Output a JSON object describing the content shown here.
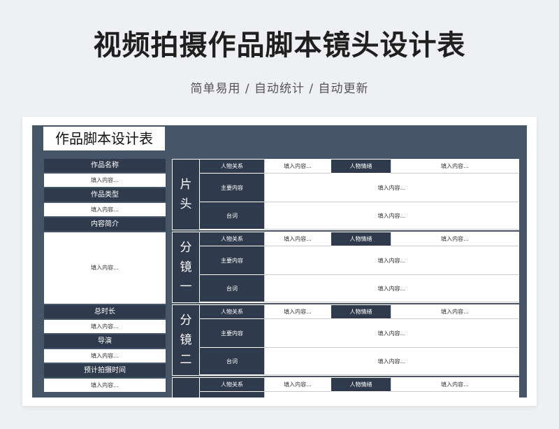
{
  "header": {
    "title": "视频拍摄作品脚本镜头设计表",
    "subtitle": "简单易用 / 自动统计 / 自动更新"
  },
  "sheet": {
    "title": "作品脚本设计表",
    "left": [
      {
        "label": "作品名称",
        "value": "填入内容..."
      },
      {
        "label": "作品类型",
        "value": "填入内容..."
      },
      {
        "label": "内容简介",
        "value": "填入内容..."
      },
      {
        "label": "总时长",
        "value": "填入内容..."
      },
      {
        "label": "导演",
        "value": "填入内容..."
      },
      {
        "label": "预计拍摄时间",
        "value": "填入内容..."
      }
    ],
    "sections": [
      {
        "label_chars": [
          "片",
          "头"
        ],
        "relation_label": "人物关系",
        "relation_value": "填入内容...",
        "emotion_label": "人物情绪",
        "emotion_value": "填入内容...",
        "content_label": "主要内容",
        "content_value": "填入内容...",
        "line_label": "台词",
        "line_value": "填入内容..."
      },
      {
        "label_chars": [
          "分",
          "镜",
          "一"
        ],
        "relation_label": "人物关系",
        "relation_value": "填入内容...",
        "emotion_label": "人物情绪",
        "emotion_value": "填入内容...",
        "content_label": "主要内容",
        "content_value": "填入内容...",
        "line_label": "台词",
        "line_value": "填入内容..."
      },
      {
        "label_chars": [
          "分",
          "镜",
          "二"
        ],
        "relation_label": "人物关系",
        "relation_value": "填入内容...",
        "emotion_label": "人物情绪",
        "emotion_value": "填入内容...",
        "content_label": "主要内容",
        "content_value": "填入内容...",
        "line_label": "台词",
        "line_value": "填入内容..."
      },
      {
        "label_chars": [],
        "relation_label": "人物关系",
        "relation_value": "填入内容...",
        "emotion_label": "人物情绪",
        "emotion_value": "填入内容...",
        "content_label": "",
        "content_value": "",
        "line_label": "",
        "line_value": ""
      }
    ]
  },
  "colors": {
    "dark": "#2f3b4c",
    "frame": "#475569",
    "background": "#eef0f3"
  }
}
